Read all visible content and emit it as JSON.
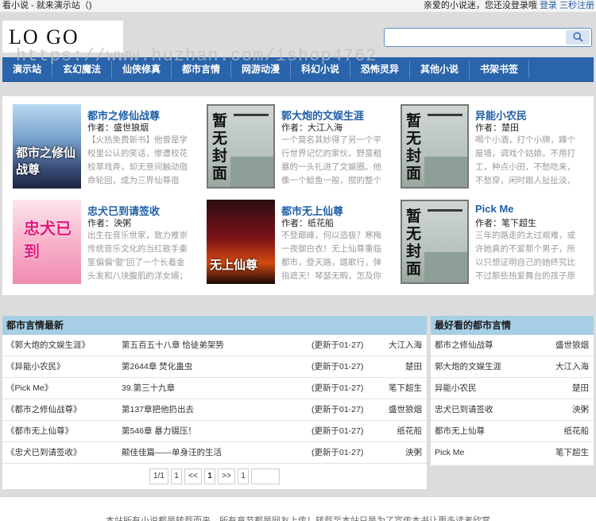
{
  "topbar": {
    "left": "看小说 - 就来演示站（)",
    "greeting": "亲爱的小说迷，您还没登录哦",
    "login": "登录",
    "register": "三秒注册"
  },
  "header": {
    "logo": "LO GO"
  },
  "search": {
    "placeholder": "",
    "icon": "search-icon"
  },
  "watermark": "https://www.huzhan.com/ishop4762",
  "nav": {
    "items": [
      "演示站",
      "玄幻魔法",
      "仙侠修真",
      "都市言情",
      "网游动漫",
      "科幻小说",
      "恐怖灵异",
      "其他小说",
      "书架书签"
    ]
  },
  "books": [
    {
      "title": "都市之修仙战尊",
      "author": "作者：盛世狼烟",
      "desc": "【火热免费新书】他曾是学校里公认的笑话，惨遭校花校草戏弄，却无意间触动宿命轮回，成为三界仙尊宿主，曾经被人虐得颤死狗一",
      "cover": "art1",
      "cover_text": "都市之修仙战尊"
    },
    {
      "title": "郭大炮的文娱生涯",
      "author": "作者：大江入海",
      "desc": "一个莫名其妙得了另一个平行世界记忆的家伙，野蛮粗暴的一头扎进了文娱圈。他像一个鲶鱼一般，搅的整个文娱圈鸡飞狗跳，人人见之",
      "cover": "placeholder",
      "cover_text": "暂无封面"
    },
    {
      "title": "异能小农民",
      "author": "作者：楚田",
      "desc": "喝个小酒，打个小牌，蹲个屋墙，调戏个姑娘。不用打工，种点小田，不愁吃来，不愁穿，闲时跟人扯扯淡，修修炼，体内有个“五行",
      "cover": "placeholder",
      "cover_text": "暂无封面"
    },
    {
      "title": "忠犬已到请签收",
      "author": "作者：泱粥",
      "desc": "出生在音乐世家，致力推崇传统音乐文化的当红歌手秦笙偏偏“娶”回了一个长着金头发和八块腹肌的洋女婿；不过，卡斯特觉得自己的",
      "cover": "art2",
      "cover_text": "忠犬已到"
    },
    {
      "title": "都市无上仙尊",
      "author": "作者：纸花船",
      "desc": "不登巅峰，何以造极？寒梅一夜御白衣！无上仙尊重临都市，登天路，踏歌行，弹指遮天！琴瑟无暇，怎及你耳畔一语情话？",
      "cover": "art3",
      "cover_text": "无上仙尊"
    },
    {
      "title": "Pick Me",
      "author": "作者：笔下超生",
      "desc": "三年的路走的太过艰难，或许她真的不爱那个男子，所以只想证明自己的她终究比不过那些热爱舞台的孩子原本只是最后一搏，却在这",
      "cover": "placeholder",
      "cover_text": "暂无封面"
    }
  ],
  "latest": {
    "heading": "都市言情最新",
    "rows": [
      {
        "book": "《郭大炮的文娱生涯》",
        "chapter": "第五百五十八章 恰徒弟架势",
        "updated": "(更新于01-27)",
        "author": "大江入海"
      },
      {
        "book": "《异能小农民》",
        "chapter": "第2644章 焚化蛊虫",
        "updated": "(更新于01-27)",
        "author": "楚田"
      },
      {
        "book": "《Pick Me》",
        "chapter": "39.第三十九章",
        "updated": "(更新于01-27)",
        "author": "笔下超生"
      },
      {
        "book": "《都市之修仙战尊》",
        "chapter": "第137章把他扔出去",
        "updated": "(更新于01-27)",
        "author": "盛世狼烟"
      },
      {
        "book": "《都市无上仙尊》",
        "chapter": "第546章 暴力镊压！",
        "updated": "(更新于01-27)",
        "author": "纸花船"
      },
      {
        "book": "《忠犬已到请签收》",
        "chapter": "颠佳佳篇——单身汪的生活",
        "updated": "(更新于01-27)",
        "author": "泱粥"
      }
    ]
  },
  "pager": {
    "info": "1/1",
    "first": "1",
    "prev": "<<",
    "current": "1",
    "next": ">>",
    "last": "1",
    "jump_value": ""
  },
  "rank": {
    "heading": "最好看的都市言情",
    "rows": [
      {
        "book": "都市之修仙战尊",
        "author": "盛世狼烟"
      },
      {
        "book": "郭大炮的文娱生涯",
        "author": "大江入海"
      },
      {
        "book": "异能小农民",
        "author": "楚田"
      },
      {
        "book": "忠犬已到请签收",
        "author": "泱粥"
      },
      {
        "book": "都市无上仙尊",
        "author": "纸花船"
      },
      {
        "book": "Pick Me",
        "author": "笔下超生"
      }
    ]
  },
  "footer": {
    "text": "本站所有小说都是转载而来，所有章节都是网友上传！转载至本站只是为了宣传本书让更多读者欣赏"
  },
  "colors": {
    "nav": "#2a64ab",
    "section_head": "#a6cfe6",
    "title_link": "#1f5fa8"
  }
}
